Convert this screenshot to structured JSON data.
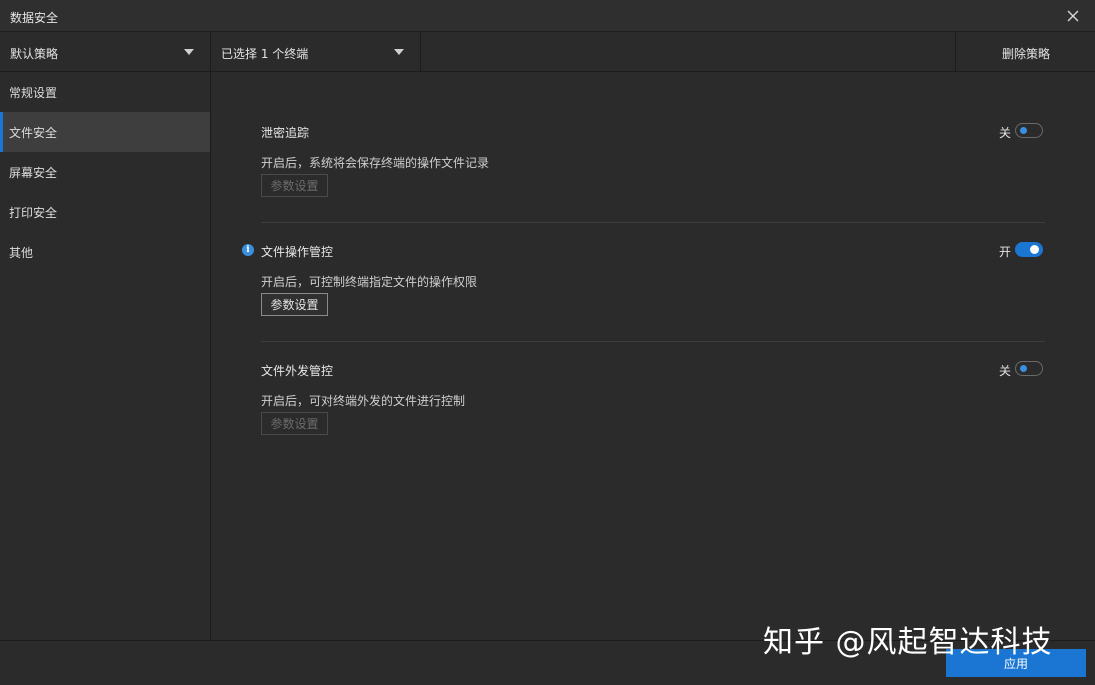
{
  "window": {
    "title": "数据安全",
    "close_icon": "close-icon"
  },
  "toolbar": {
    "policy_select": "默认策略",
    "terminal_select": "已选择 1 个终端",
    "delete_label": "删除策略"
  },
  "sidebar": {
    "items": [
      {
        "label": "常规设置",
        "active": false
      },
      {
        "label": "文件安全",
        "active": true
      },
      {
        "label": "屏幕安全",
        "active": false
      },
      {
        "label": "打印安全",
        "active": false
      },
      {
        "label": "其他",
        "active": false
      }
    ]
  },
  "sections": [
    {
      "title": "泄密追踪",
      "description": "开启后，系统将会保存终端的操作文件记录",
      "toggle_state": "关",
      "enabled": false,
      "param_label": "参数设置"
    },
    {
      "title": "文件操作管控",
      "description": "开启后，可控制终端指定文件的操作权限",
      "toggle_state": "开",
      "enabled": true,
      "param_label": "参数设置",
      "info_icon": "i"
    },
    {
      "title": "文件外发管控",
      "description": "开启后，可对终端外发的文件进行控制",
      "toggle_state": "关",
      "enabled": false,
      "param_label": "参数设置"
    }
  ],
  "footer": {
    "apply_label": "应用"
  },
  "watermark": "知乎 @风起智达科技",
  "colors": {
    "accent": "#1a76d2",
    "background": "#2b2b2b",
    "info": "#3a8fde"
  }
}
